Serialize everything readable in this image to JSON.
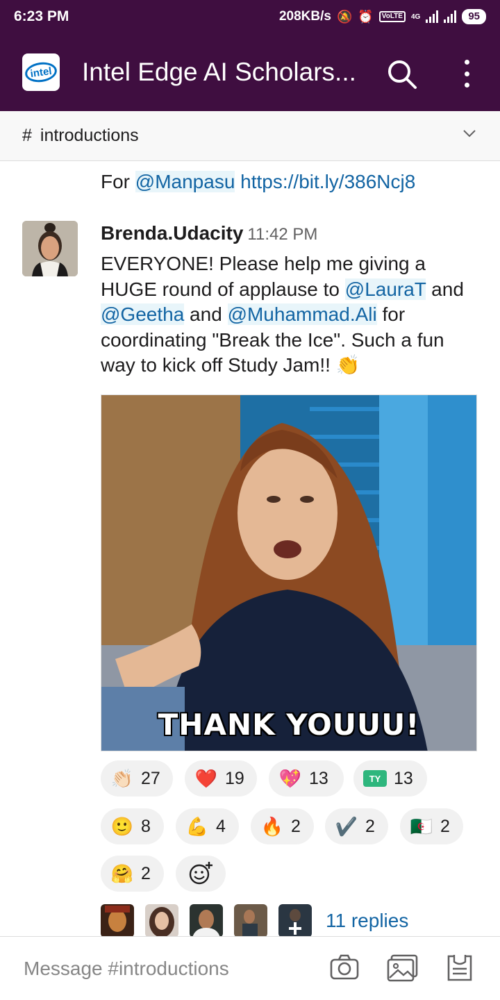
{
  "status_bar": {
    "time": "6:23 PM",
    "speed": "208KB/s",
    "network": "4G",
    "battery": "95"
  },
  "app_bar": {
    "logo_text": "intel",
    "title": "Intel Edge AI Scholars..."
  },
  "channel": {
    "hash": "#",
    "name": "introductions"
  },
  "previous_message": {
    "prefix": "For",
    "mention": "@Manpasu",
    "link": "https://bit.ly/386Ncj8"
  },
  "message": {
    "author": "Brenda.Udacity",
    "time": "11:42 PM",
    "text_1": "EVERYONE! Please help me giving a HUGE round of applause to ",
    "mention_1": "@LauraT",
    "text_2": " and ",
    "mention_2": "@Geetha",
    "text_3": " and ",
    "mention_3": "@Muhammad.Ali",
    "text_4": " for coordinating \"Break the Ice\". Such a fun way to kick off Study Jam!! ",
    "emoji": "👏",
    "gif_caption": "THANK YOUUU!"
  },
  "reactions": [
    {
      "emoji": "👏🏻",
      "count": "27"
    },
    {
      "emoji": "❤️",
      "count": "19"
    },
    {
      "emoji": "💖",
      "count": "13"
    },
    {
      "emoji": "TY",
      "count": "13"
    },
    {
      "emoji": "🙂",
      "count": "8"
    },
    {
      "emoji": "💪",
      "count": "4"
    },
    {
      "emoji": "🔥",
      "count": "2"
    },
    {
      "emoji": "✔️",
      "count": "2"
    },
    {
      "emoji": "🇩🇿",
      "count": "2"
    },
    {
      "emoji": "🤗",
      "count": "2"
    }
  ],
  "thread": {
    "replies_label": "11 replies"
  },
  "composer": {
    "placeholder": "Message #introductions"
  },
  "colors": {
    "brand_aubergine": "#3f0e40",
    "link_blue": "#1264a3",
    "mention_bg": "#e8f5fa",
    "reaction_bg": "#f1f1f1"
  }
}
